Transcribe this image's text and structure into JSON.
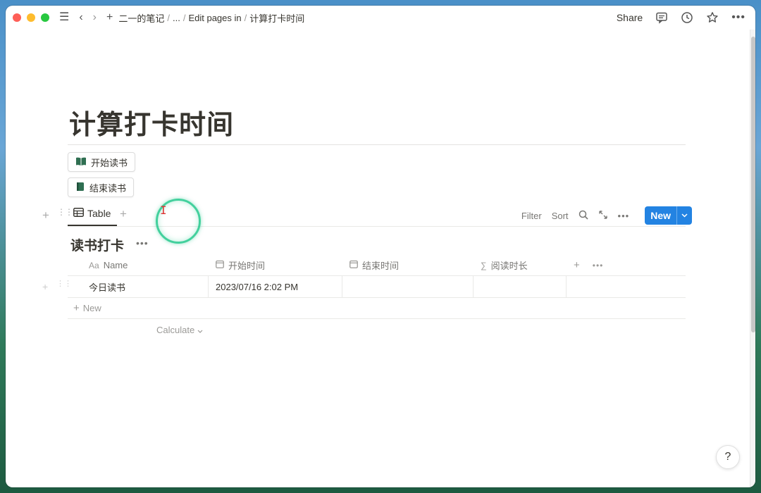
{
  "breadcrumbs": [
    "二一的笔记",
    "...",
    "Edit pages in",
    "计算打卡时间"
  ],
  "header": {
    "share_label": "Share"
  },
  "page": {
    "title": "计算打卡时间"
  },
  "buttons": [
    {
      "label": "开始读书",
      "icon": "open-book-icon",
      "color": "#2f6f52"
    },
    {
      "label": "结束读书",
      "icon": "closed-book-icon",
      "color": "#2f6f52"
    }
  ],
  "view": {
    "tab_label": "Table",
    "tools": {
      "filter": "Filter",
      "sort": "Sort"
    },
    "new_label": "New"
  },
  "database": {
    "title": "读书打卡",
    "columns": [
      {
        "label": "Name",
        "icon_text": "Aa"
      },
      {
        "label": "开始时间",
        "icon": "calendar-icon"
      },
      {
        "label": "结束时间",
        "icon": "calendar-icon"
      },
      {
        "label": "阅读时长",
        "icon_text": "∑"
      }
    ],
    "rows": [
      {
        "name": "今日读书",
        "start": "2023/07/16 2:02 PM",
        "end": "",
        "duration": ""
      }
    ],
    "new_row_label": "New",
    "calculate_label": "Calculate"
  },
  "help": {
    "label": "?"
  },
  "colors": {
    "accent": "#2383e2",
    "text": "#37352f",
    "muted": "#787774",
    "click_ring": "#22c88c"
  }
}
